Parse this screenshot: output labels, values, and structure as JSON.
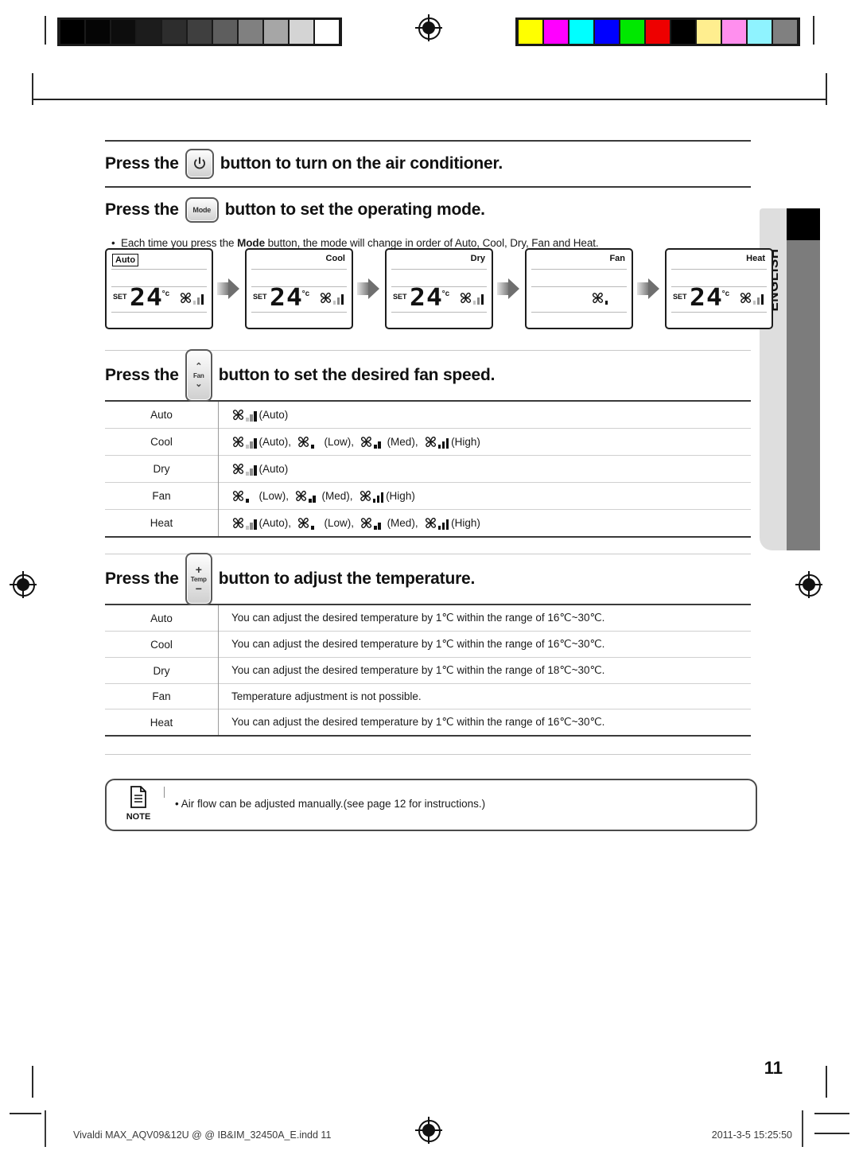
{
  "page": {
    "number": "11",
    "language_tab": "ENGLISH"
  },
  "calibration": {
    "grayscale": [
      "#000000",
      "#050505",
      "#0d0d0d",
      "#1c1c1c",
      "#2d2d2d",
      "#3f3f3f",
      "#5e5e5e",
      "#808080",
      "#a6a6a6",
      "#d4d4d4",
      "#ffffff"
    ],
    "colors": [
      "#ffff00",
      "#ff00ff",
      "#00ffff",
      "#0000ff",
      "#00e800",
      "#ee0000",
      "#000000",
      "#ffee8f",
      "#ff8fee",
      "#8ff3ff",
      "#808080"
    ]
  },
  "sections": [
    {
      "id": "power",
      "prefix": "Press the",
      "button": "power-button",
      "button_label": "",
      "suffix": "button to turn on the air conditioner."
    },
    {
      "id": "mode",
      "prefix": "Press the",
      "button": "mode-button",
      "button_label": "Mode",
      "suffix": "button to set the operating mode."
    },
    {
      "id": "fan",
      "prefix": "Press the",
      "button": "fan-button",
      "button_label": "Fan",
      "suffix": "button to set the desired fan speed."
    },
    {
      "id": "temp",
      "prefix": "Press the",
      "button": "temp-button",
      "button_label": "Temp",
      "suffix": "button to adjust the temperature."
    }
  ],
  "mode_bullet": {
    "pre": "Each time you press the ",
    "bold": "Mode",
    "post": " button, the mode will change in order of Auto, Cool, Dry, Fan and Heat."
  },
  "lcd_sequence": [
    {
      "mode": "Auto",
      "boxed": true,
      "set_label": "SET",
      "temperature": "24",
      "unit": "°c",
      "show_temp": true,
      "fan_level": "auto"
    },
    {
      "mode": "Cool",
      "boxed": false,
      "set_label": "SET",
      "temperature": "24",
      "unit": "°c",
      "show_temp": true,
      "fan_level": "auto"
    },
    {
      "mode": "Dry",
      "boxed": false,
      "set_label": "SET",
      "temperature": "24",
      "unit": "°c",
      "show_temp": true,
      "fan_level": "auto"
    },
    {
      "mode": "Fan",
      "boxed": false,
      "set_label": "",
      "temperature": "",
      "unit": "",
      "show_temp": false,
      "fan_level": "low"
    },
    {
      "mode": "Heat",
      "boxed": false,
      "set_label": "SET",
      "temperature": "24",
      "unit": "°c",
      "show_temp": true,
      "fan_level": "auto"
    }
  ],
  "fan_speed_table": [
    {
      "mode": "Auto",
      "options": [
        {
          "level": "auto",
          "label": "(Auto)"
        }
      ]
    },
    {
      "mode": "Cool",
      "options": [
        {
          "level": "auto",
          "label": "(Auto)"
        },
        {
          "level": "low",
          "label": "(Low)"
        },
        {
          "level": "med",
          "label": "(Med)"
        },
        {
          "level": "high",
          "label": "(High)"
        }
      ]
    },
    {
      "mode": "Dry",
      "options": [
        {
          "level": "auto",
          "label": "(Auto)"
        }
      ]
    },
    {
      "mode": "Fan",
      "options": [
        {
          "level": "low",
          "label": "(Low)"
        },
        {
          "level": "med",
          "label": "(Med)"
        },
        {
          "level": "high",
          "label": "(High)"
        }
      ]
    },
    {
      "mode": "Heat",
      "options": [
        {
          "level": "auto",
          "label": "(Auto)"
        },
        {
          "level": "low",
          "label": "(Low)"
        },
        {
          "level": "med",
          "label": "(Med)"
        },
        {
          "level": "high",
          "label": "(High)"
        }
      ]
    }
  ],
  "temperature_table": [
    {
      "mode": "Auto",
      "text": "You can adjust the desired temperature by 1℃ within the range of 16℃~30℃."
    },
    {
      "mode": "Cool",
      "text": "You can adjust the desired temperature by 1℃ within the range of 16℃~30℃."
    },
    {
      "mode": "Dry",
      "text": "You can adjust the desired temperature by 1℃ within the range of 18℃~30℃."
    },
    {
      "mode": "Fan",
      "text": "Temperature adjustment is not possible."
    },
    {
      "mode": "Heat",
      "text": "You can adjust the desired temperature by 1℃ within the range of 16℃~30℃."
    }
  ],
  "note": {
    "caption": "NOTE",
    "text": "•  Air flow can be adjusted manually.(see page 12 for instructions.)"
  },
  "footer": {
    "left": "Vivaldi MAX_AQV09&12U @ @ IB&IM_32450A_E.indd   11",
    "right": "2011-3-5   15:25:50"
  }
}
